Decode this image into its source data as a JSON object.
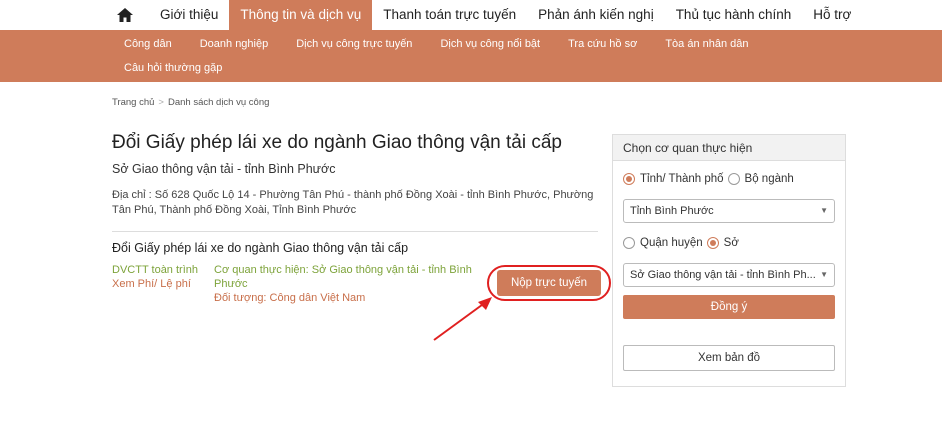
{
  "topnav": {
    "items": [
      "Giới thiệu",
      "Thông tin và dịch vụ",
      "Thanh toán trực tuyến",
      "Phản ánh kiến nghị",
      "Thủ tục hành chính",
      "Hỗ trợ"
    ],
    "active_index": 1
  },
  "subnav": {
    "row1": [
      "Công dân",
      "Doanh nghiệp",
      "Dịch vụ công trực tuyến",
      "Dịch vụ công nổi bật",
      "Tra cứu hồ sơ",
      "Tòa án nhân dân"
    ],
    "row2": [
      "Câu hỏi thường gặp"
    ]
  },
  "breadcrumb": {
    "home": "Trang chủ",
    "separator": ">",
    "current": "Danh sách dịch vụ công"
  },
  "main": {
    "title": "Đổi Giấy phép lái xe do ngành Giao thông vận tải cấp",
    "agency": "Sở Giao thông vận tải - tỉnh Bình Phước",
    "address": "Địa chỉ : Số 628 Quốc Lộ 14 - Phường Tân Phú - thành phố Đồng Xoài - tỉnh Bình Phước, Phường Tân Phú, Thành phố Đồng Xoài, Tỉnh Bình Phước",
    "service": {
      "title": "Đổi Giấy phép lái xe do ngành Giao thông vận tải cấp",
      "level": "DVCTT toàn trình",
      "fee_link": "Xem Phí/ Lệ phí",
      "agency_line": "Cơ quan thực hiện: Sở Giao thông vận tải - tỉnh Bình Phước",
      "target_line": "Đối tượng: Công dân Việt Nam",
      "submit_label": "Nộp trực tuyến"
    }
  },
  "panel": {
    "title": "Chọn cơ quan thực hiện",
    "radio_province": "Tỉnh/ Thành phố",
    "radio_ministry": "Bộ ngành",
    "province_select": "Tỉnh Bình Phước",
    "radio_district": "Quận huyện",
    "radio_department": "Sở",
    "department_select": "Sở Giao thông vận tải - tỉnh Bình Ph...",
    "agree_label": "Đồng ý",
    "map_label": "Xem bản đồ"
  },
  "colors": {
    "accent": "#cf7c5a",
    "highlight_ring": "#e02020",
    "level_green": "#7da33a"
  }
}
